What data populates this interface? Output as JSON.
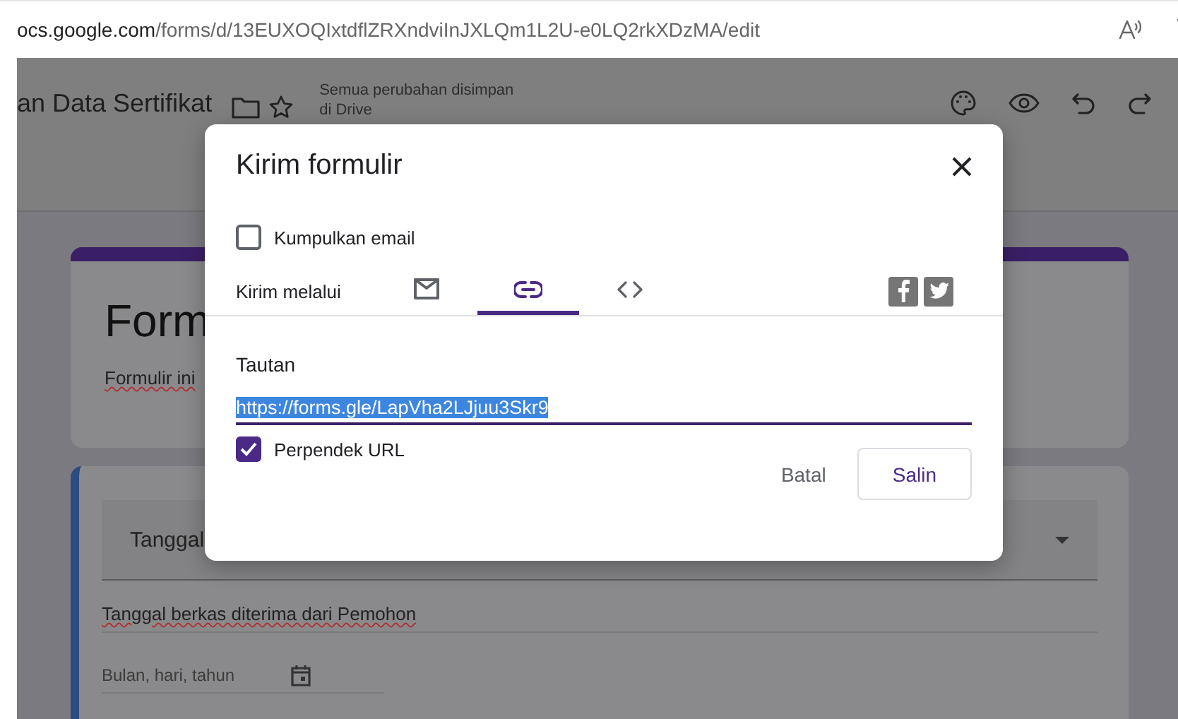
{
  "browser": {
    "url_host": "ocs.google.com",
    "url_path": "/forms/d/13EUXOQIxtdflZRXndviInJXLQm1L2U-e0LQ2rkXDzMA/edit"
  },
  "header": {
    "title": "an Data Sertifikat",
    "save_status": [
      "Semua perubahan disimpan",
      "di Drive"
    ]
  },
  "form": {
    "title": "Form",
    "description": "Formulir ini",
    "question": {
      "field_text": "Tanggal",
      "text": "Tanggal berkas diterima dari Pemohon",
      "date_placeholder": "Bulan, hari, tahun"
    }
  },
  "dialog": {
    "title": "Kirim formulir",
    "collect_email": {
      "label": "Kumpulkan email",
      "checked": false
    },
    "send_via_label": "Kirim melalui",
    "tabs": [
      {
        "kind": "email",
        "selected": false
      },
      {
        "kind": "link",
        "selected": true
      },
      {
        "kind": "embed",
        "selected": false
      }
    ],
    "link_heading": "Tautan",
    "link_value": "https://forms.gle/LapVha2LJjuu3Skr9",
    "shorten_url": {
      "label": "Perpendek URL",
      "checked": true
    },
    "buttons": [
      {
        "label": "Batal",
        "kind": "text"
      },
      {
        "label": "Salin",
        "kind": "outlined"
      }
    ]
  }
}
